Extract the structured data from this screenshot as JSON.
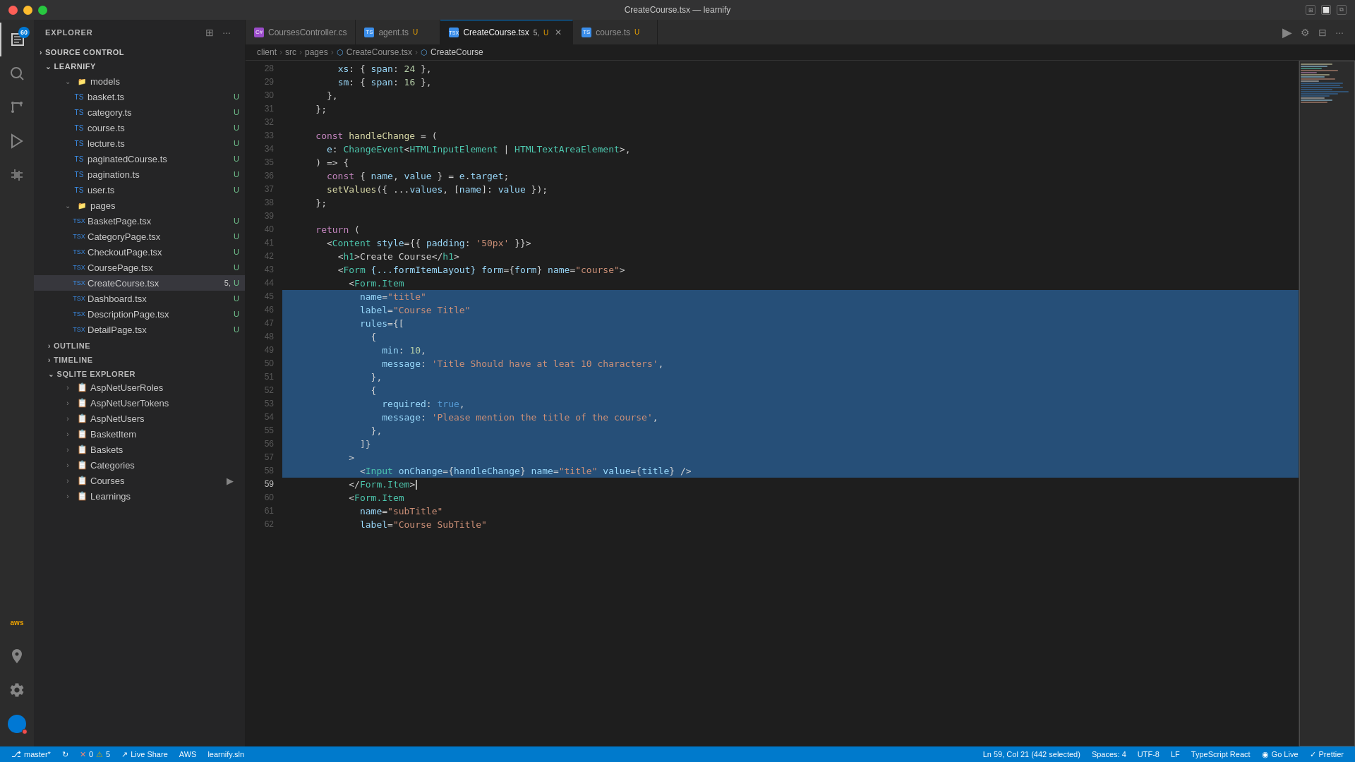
{
  "window": {
    "title": "CreateCourse.tsx — learnify"
  },
  "titlebar": {
    "buttons": [
      "close",
      "minimize",
      "maximize"
    ],
    "right_icons": [
      "grid-icon",
      "window-icon",
      "split-icon"
    ]
  },
  "activity_bar": {
    "icons": [
      {
        "name": "explorer-icon",
        "label": "Explorer",
        "active": true,
        "badge": "60"
      },
      {
        "name": "search-icon",
        "label": "Search",
        "active": false
      },
      {
        "name": "source-control-icon",
        "label": "Source Control",
        "active": false
      },
      {
        "name": "run-icon",
        "label": "Run",
        "active": false
      },
      {
        "name": "extensions-icon",
        "label": "Extensions",
        "active": false
      }
    ],
    "bottom_icons": [
      {
        "name": "remote-icon",
        "label": "Remote"
      },
      {
        "name": "account-icon",
        "label": "Account",
        "badge": "1"
      }
    ]
  },
  "sidebar": {
    "title": "EXPLORER",
    "source_control_label": "SOURCE CONTROL",
    "learnify_label": "LEARNIFY",
    "models_folder": "models",
    "models_dot": "orange",
    "pages_folder": "pages",
    "pages_dot": "orange",
    "files_models": [
      {
        "name": "basket.ts",
        "badge": "U"
      },
      {
        "name": "category.ts",
        "badge": "U"
      },
      {
        "name": "course.ts",
        "badge": "U"
      },
      {
        "name": "lecture.ts",
        "badge": "U"
      },
      {
        "name": "paginatedCourse.ts",
        "badge": "U"
      },
      {
        "name": "pagination.ts",
        "badge": "U"
      },
      {
        "name": "user.ts",
        "badge": "U"
      }
    ],
    "files_pages": [
      {
        "name": "BasketPage.tsx",
        "badge": "U"
      },
      {
        "name": "CategoryPage.tsx",
        "badge": "U"
      },
      {
        "name": "CheckoutPage.tsx",
        "badge": "U"
      },
      {
        "name": "CoursePage.tsx",
        "badge": "U"
      },
      {
        "name": "CreateCourse.tsx",
        "badge": "U",
        "num": "5",
        "active": true
      },
      {
        "name": "Dashboard.tsx",
        "badge": "U"
      },
      {
        "name": "DescriptionPage.tsx",
        "badge": "U"
      },
      {
        "name": "DetailPage.tsx",
        "badge": "U"
      }
    ],
    "outline_label": "OUTLINE",
    "timeline_label": "TIMELINE",
    "sqlite_label": "SQLITE EXPLORER",
    "sqlite_items": [
      {
        "name": "AspNetUserRoles"
      },
      {
        "name": "AspNetUserTokens"
      },
      {
        "name": "AspNetUsers"
      },
      {
        "name": "BasketItem"
      },
      {
        "name": "Baskets"
      },
      {
        "name": "Categories"
      },
      {
        "name": "Courses",
        "has_expand": true
      },
      {
        "name": "Learnings"
      }
    ]
  },
  "tabs": [
    {
      "name": "CoursesController.cs",
      "active": false,
      "modified": false,
      "icon_color": "#9b4dca"
    },
    {
      "name": "agent.ts",
      "active": false,
      "modified": true,
      "badge": "U",
      "icon_color": "#3b8eea"
    },
    {
      "name": "CreateCourse.tsx",
      "active": true,
      "modified": true,
      "badge_num": "5",
      "badge_u": "U",
      "icon_color": "#3b8eea"
    },
    {
      "name": "course.ts",
      "active": false,
      "modified": true,
      "badge": "U",
      "icon_color": "#3b8eea"
    }
  ],
  "breadcrumb": {
    "items": [
      "client",
      "src",
      "pages",
      "CreateCourse.tsx",
      "CreateCourse"
    ]
  },
  "toolbar": {
    "run_label": "▶",
    "debug_label": "⚙",
    "split_label": "⊟",
    "more_label": "..."
  },
  "code": {
    "lines": [
      {
        "num": 28,
        "content": "        xs: { span: 24 },",
        "selected": false
      },
      {
        "num": 29,
        "content": "        sm: { span: 16 },",
        "selected": false
      },
      {
        "num": 30,
        "content": "      },",
        "selected": false
      },
      {
        "num": 31,
        "content": "    };",
        "selected": false
      },
      {
        "num": 32,
        "content": "",
        "selected": false
      },
      {
        "num": 33,
        "content": "    const handleChange = (",
        "selected": false
      },
      {
        "num": 34,
        "content": "      e: ChangeEvent<HTMLInputElement | HTMLTextAreaElement>,",
        "selected": false
      },
      {
        "num": 35,
        "content": "    ) => {",
        "selected": false
      },
      {
        "num": 36,
        "content": "      const { name, value } = e.target;",
        "selected": false
      },
      {
        "num": 37,
        "content": "      setValues({ ...values, [name]: value });",
        "selected": false
      },
      {
        "num": 38,
        "content": "    };",
        "selected": false
      },
      {
        "num": 39,
        "content": "",
        "selected": false
      },
      {
        "num": 40,
        "content": "    return (",
        "selected": false
      },
      {
        "num": 41,
        "content": "      <Content style={{ padding: '50px' }}>",
        "selected": false
      },
      {
        "num": 42,
        "content": "        <h1>Create Course</h1>",
        "selected": false
      },
      {
        "num": 43,
        "content": "        <Form {...formItemLayout} form={form} name=\"course\">",
        "selected": false
      },
      {
        "num": 44,
        "content": "          <Form.Item",
        "selected": false,
        "gutter": true
      },
      {
        "num": 45,
        "content": "            name=\"title\"",
        "selected": true
      },
      {
        "num": 46,
        "content": "            label=\"Course Title\"",
        "selected": true
      },
      {
        "num": 47,
        "content": "            rules={[",
        "selected": true
      },
      {
        "num": 48,
        "content": "              {",
        "selected": true
      },
      {
        "num": 49,
        "content": "                min: 10,",
        "selected": true
      },
      {
        "num": 50,
        "content": "                message: 'Title Should have at leat 10 characters',",
        "selected": true
      },
      {
        "num": 51,
        "content": "              },",
        "selected": true
      },
      {
        "num": 52,
        "content": "              {",
        "selected": true
      },
      {
        "num": 53,
        "content": "                required: true,",
        "selected": true
      },
      {
        "num": 54,
        "content": "                message: 'Please mention the title of the course',",
        "selected": true
      },
      {
        "num": 55,
        "content": "              },",
        "selected": true
      },
      {
        "num": 56,
        "content": "            ]}",
        "selected": true
      },
      {
        "num": 57,
        "content": "          >",
        "selected": true
      },
      {
        "num": 58,
        "content": "            <Input onChange={handleChange} name=\"title\" value={title} />",
        "selected": true
      },
      {
        "num": 59,
        "content": "          </Form.Item>",
        "selected": false
      },
      {
        "num": 60,
        "content": "          <Form.Item",
        "selected": false
      },
      {
        "num": 61,
        "content": "            name=\"subTitle\"",
        "selected": false
      },
      {
        "num": 62,
        "content": "            label=\"Course SubTitle\"",
        "selected": false
      }
    ]
  },
  "status_bar": {
    "branch": "master*",
    "sync": "",
    "errors": "0",
    "warnings": "5",
    "live_share": "Live Share",
    "aws": "AWS",
    "sln": "learnify.sln",
    "cursor": "Ln 59, Col 21 (442 selected)",
    "spaces": "Spaces: 4",
    "encoding": "UTF-8",
    "line_ending": "LF",
    "language": "TypeScript React",
    "go_live": "Go Live",
    "prettier": "Prettier"
  }
}
